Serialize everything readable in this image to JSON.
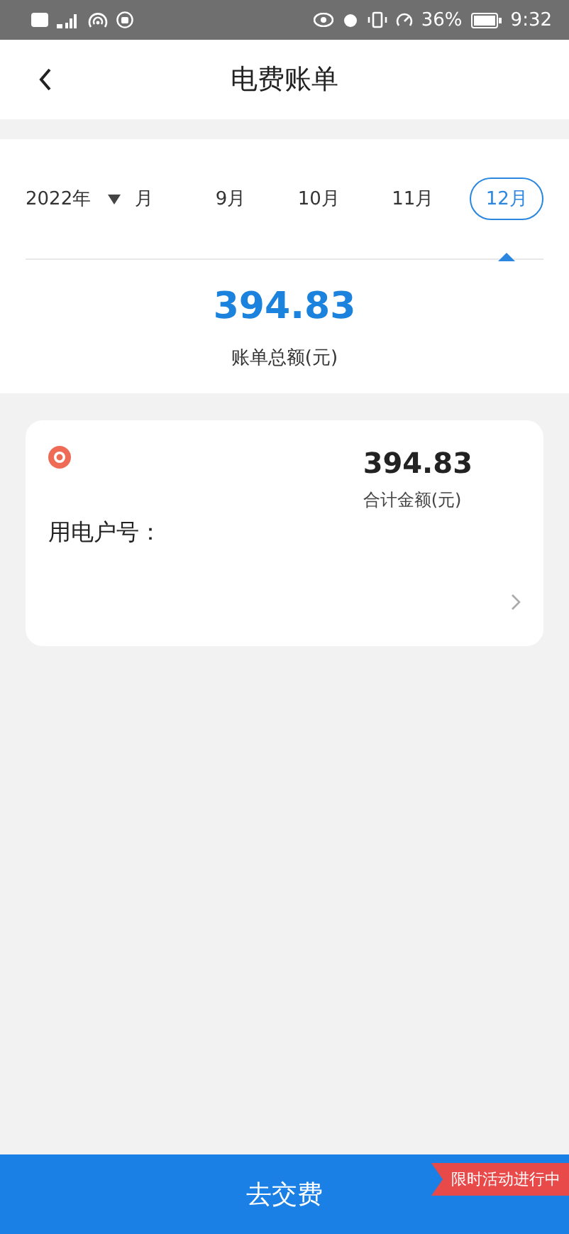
{
  "status_bar": {
    "battery": "36%",
    "time": "9:32"
  },
  "header": {
    "title": "电费账单"
  },
  "period": {
    "year": "2022年",
    "month_label": "月",
    "months": [
      {
        "label": "9月",
        "selected": false
      },
      {
        "label": "10月",
        "selected": false
      },
      {
        "label": "11月",
        "selected": false
      },
      {
        "label": "12月",
        "selected": true
      }
    ]
  },
  "summary": {
    "amount": "394.83",
    "label": "账单总额(元)"
  },
  "bill_card": {
    "amount": "394.83",
    "amount_label": "合计金额(元)",
    "account_label": "用电户号："
  },
  "pay_button": {
    "label": "去交费",
    "badge": "限时活动进行中"
  }
}
